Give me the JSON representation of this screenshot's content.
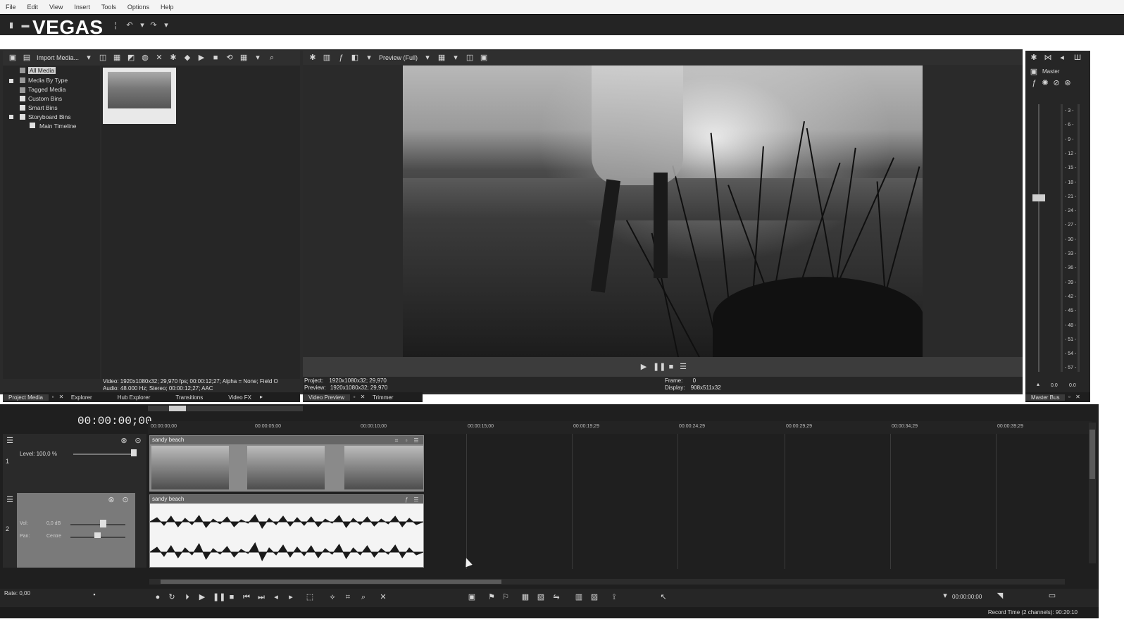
{
  "menu": [
    "File",
    "Edit",
    "View",
    "Insert",
    "Tools",
    "Options",
    "Help"
  ],
  "app": {
    "logo": "VEGAS"
  },
  "project_media": {
    "import_label": "Import Media...",
    "tree": [
      {
        "label": "All Media",
        "selected": true
      },
      {
        "label": "Media By Type"
      },
      {
        "label": "Tagged Media"
      },
      {
        "label": "Custom Bins"
      },
      {
        "label": "Smart Bins"
      },
      {
        "label": "Storyboard Bins"
      },
      {
        "label": "Main Timeline"
      }
    ],
    "info_video": "Video: 1920x1080x32; 29,970 fps; 00:00:12;27; Alpha = None; Field O",
    "info_audio": "Audio: 48.000 Hz; Stereo; 00:00:12;27; AAC",
    "tabs": [
      "Project Media",
      "Explorer",
      "Hub Explorer",
      "Transitions",
      "Video FX"
    ]
  },
  "preview": {
    "mode_label": "Preview (Full)",
    "project_label": "Project:",
    "project_value": "1920x1080x32; 29,970",
    "preview_label": "Preview:",
    "preview_value": "1920x1080x32; 29,970",
    "frame_label": "Frame:",
    "frame_value": "0",
    "display_label": "Display:",
    "display_value": "908x511x32",
    "tabs": [
      "Video Preview",
      "Trimmer"
    ]
  },
  "master": {
    "label": "Master",
    "ticks": [
      "3",
      "6",
      "9",
      "12",
      "15",
      "18",
      "21",
      "24",
      "27",
      "30",
      "33",
      "36",
      "39",
      "42",
      "45",
      "48",
      "51",
      "54",
      "57"
    ],
    "left_value": "0.0",
    "right_value": "0.0",
    "tab": "Master Bus"
  },
  "timeline": {
    "time": "00:00:00;00",
    "ruler": [
      "00:00:00;00",
      "00:00:05;00",
      "00:00:10;00",
      "00:00:15;00",
      "00:00:19;29",
      "00:00:24;29",
      "00:00:29;29",
      "00:00:34;29",
      "00:00:39;29"
    ],
    "video_track": {
      "number": "1",
      "level": "Level: 100,0 %",
      "clip": "sandy beach"
    },
    "audio_track": {
      "number": "2",
      "vol_label": "Vol:",
      "vol_value": "0,0 dB",
      "pan_label": "Pan:",
      "pan_value": "Centre",
      "clip": "sandy beach"
    },
    "rate": "Rate: 0,00",
    "end_time": "00:00:00;00",
    "record_time": "Record Time (2 channels): 90:20:10"
  }
}
